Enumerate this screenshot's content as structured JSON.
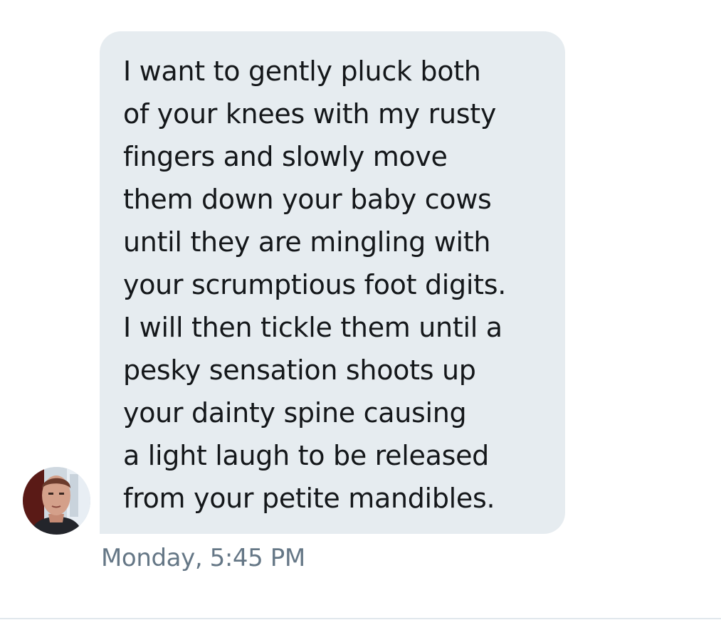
{
  "message": {
    "lines": [
      "I want to gently pluck both",
      "of your knees with my rusty",
      "fingers and slowly move",
      "them down your baby cows",
      "until they are mingling with",
      "your scrumptious foot digits.",
      "I will then tickle them until a",
      "pesky sensation shoots up",
      "your dainty spine causing",
      "a light laugh to be released",
      "from your petite mandibles."
    ],
    "timestamp": "Monday, 5:45 PM",
    "bubble_color": "#e6ecf0",
    "text_color": "#14171a",
    "timestamp_color": "#657786"
  },
  "sender": {
    "avatar_icon": "user-avatar-photo"
  }
}
